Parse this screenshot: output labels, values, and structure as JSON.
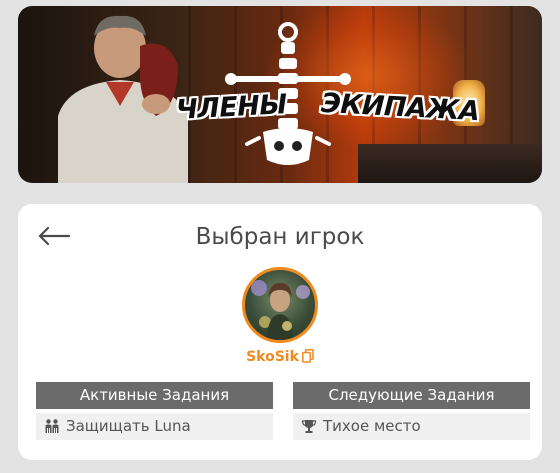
{
  "banner": {
    "logo_left_text": "ЧЛЕНЫ",
    "logo_right_text": "ЭКИПАЖА"
  },
  "card": {
    "title": "Выбран игрок",
    "player": {
      "name": "SkoSik"
    },
    "sections": {
      "active_header": "Активные Задания",
      "next_header": "Следующие Задания"
    },
    "active_tasks": [
      {
        "label": "Защищать Luna",
        "icon": "people-icon"
      }
    ],
    "next_tasks": [
      {
        "label": "Тихое место",
        "icon": "trophy-icon"
      }
    ]
  },
  "colors": {
    "accent": "#f08a1e",
    "header_bg": "#6b6b6b",
    "row_bg": "#f0f0f0",
    "page_bg": "#e3e3e3"
  }
}
